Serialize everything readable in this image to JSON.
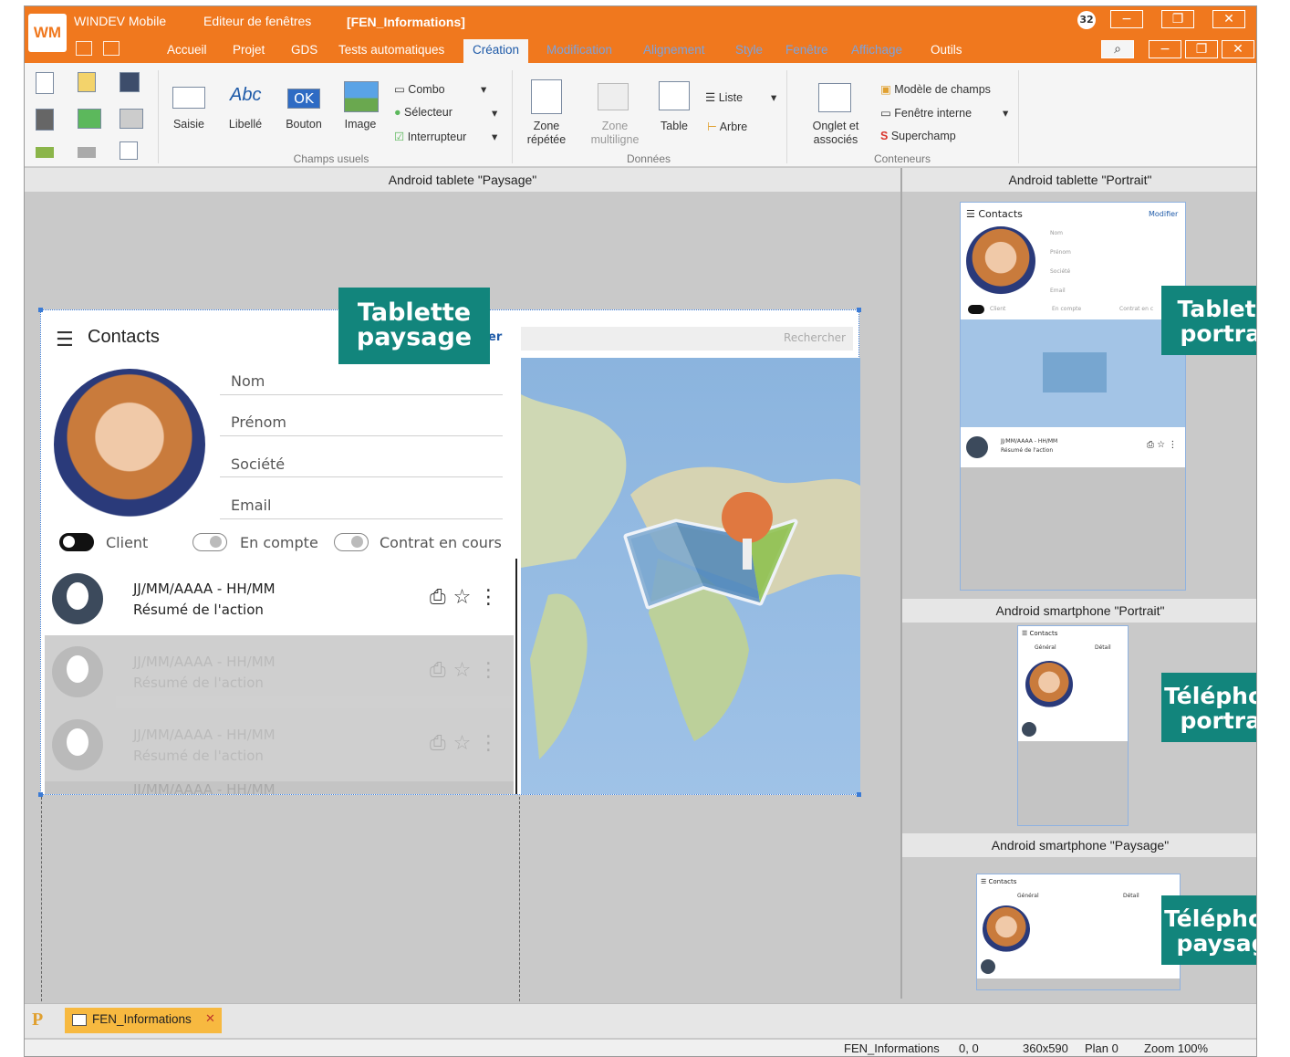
{
  "app": {
    "logo": "WM",
    "name": "WINDEV Mobile",
    "editor": "Editeur de fenêtres",
    "window_name": "[FEN_Informations]",
    "notif_count": "32"
  },
  "menu_tabs": [
    "Accueil",
    "Projet",
    "GDS",
    "Tests automatiques",
    "Création",
    "Modification",
    "Alignement",
    "Style",
    "Fenêtre",
    "Affichage",
    "Outils"
  ],
  "ribbon": {
    "saisie": "Saisie",
    "libelle": "Libellé",
    "bouton": "Bouton",
    "image": "Image",
    "combo": "Combo",
    "selecteur": "Sélecteur",
    "interrupteur": "Interrupteur",
    "zone_repetee": "Zone répétée",
    "zone_multiligne": "Zone multiligne",
    "table": "Table",
    "liste": "Liste",
    "arbre": "Arbre",
    "onglet": "Onglet et associés",
    "modele_champs": "Modèle de champs",
    "fenetre_interne": "Fenêtre interne",
    "superchamp": "Superchamp",
    "groups": {
      "champs_usuels": "Champs usuels",
      "donnees": "Données",
      "conteneurs": "Conteneurs"
    }
  },
  "panes": {
    "tablet_landscape": "Android tablete \"Paysage\"",
    "tablet_portrait": "Android tablette \"Portrait\"",
    "phone_portrait": "Android smartphone \"Portrait\"",
    "phone_landscape": "Android smartphone \"Paysage\""
  },
  "form": {
    "title": "Contacts",
    "modify": "er",
    "search_placeholder": "Rechercher",
    "fields": [
      "Nom",
      "Prénom",
      "Société",
      "Email"
    ],
    "toggles": [
      "Client",
      "En compte",
      "Contrat en cours"
    ],
    "row_date": "JJ/MM/AAAA - HH/MM",
    "row_summary": "Résumé de l'action"
  },
  "mini": {
    "title": "Contacts",
    "modify": "Modifier",
    "general": "Général",
    "detail": "Détail",
    "fields": [
      "Nom",
      "Prénom",
      "Société",
      "Email"
    ],
    "toggles": [
      "Client",
      "En compte",
      "Contrat en c"
    ],
    "row_date": "JJ/MM/AAAA - HH/MM",
    "row_summary": "Résumé de l'action"
  },
  "callouts": {
    "tablet_landscape_1": "Tablette",
    "tablet_landscape_2": "paysage",
    "tablet_portrait_1": "Tablette",
    "tablet_portrait_2": "portrait",
    "phone_portrait_1": "Téléphone",
    "phone_portrait_2": "portrait",
    "phone_landscape_1": "Téléphone",
    "phone_landscape_2": "paysage"
  },
  "bottom": {
    "doc_tab": "FEN_Informations"
  },
  "status": {
    "name": "FEN_Informations",
    "coords": "0, 0",
    "size": "360x590",
    "plan": "Plan 0",
    "zoom": "Zoom 100%"
  },
  "colors": {
    "accent": "#f0781e",
    "callout": "#12857c",
    "selection": "#3b7bd5"
  }
}
